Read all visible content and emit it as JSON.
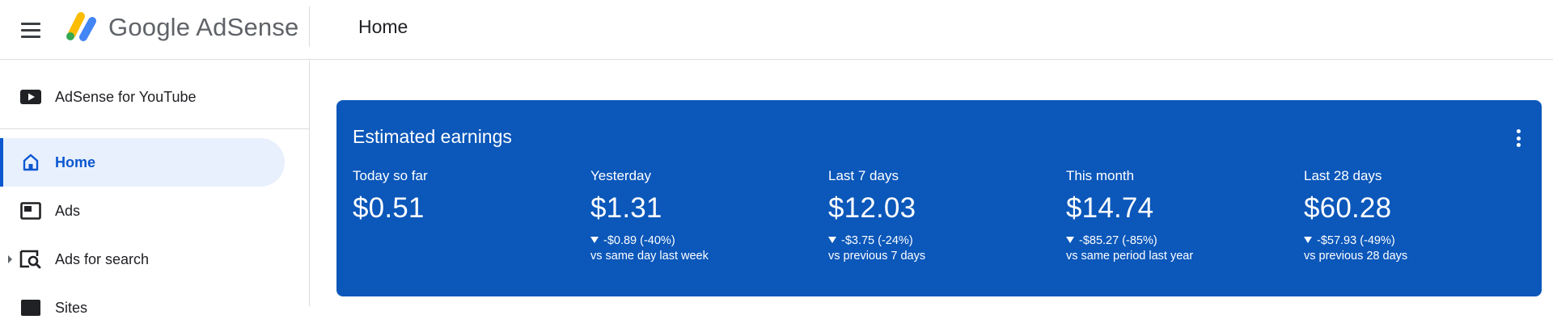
{
  "header": {
    "brand": "Google AdSense",
    "page_title": "Home"
  },
  "sidebar": {
    "items": [
      {
        "label": "AdSense for YouTube",
        "icon": "youtube-icon"
      },
      {
        "label": "Home",
        "icon": "home-icon",
        "active": true
      },
      {
        "label": "Ads",
        "icon": "ads-icon"
      },
      {
        "label": "Ads for search",
        "icon": "search-ads-icon"
      },
      {
        "label": "Sites",
        "icon": "sites-icon"
      }
    ]
  },
  "earnings": {
    "title": "Estimated earnings",
    "metrics": [
      {
        "label": "Today so far",
        "value": "$0.51",
        "change": "",
        "compare": ""
      },
      {
        "label": "Yesterday",
        "value": "$1.31",
        "change": "-$0.89 (-40%)",
        "compare": "vs same day last week"
      },
      {
        "label": "Last 7 days",
        "value": "$12.03",
        "change": "-$3.75 (-24%)",
        "compare": "vs previous 7 days"
      },
      {
        "label": "This month",
        "value": "$14.74",
        "change": "-$85.27 (-85%)",
        "compare": "vs same period last year"
      },
      {
        "label": "Last 28 days",
        "value": "$60.28",
        "change": "-$57.93 (-49%)",
        "compare": "vs previous 28 days"
      }
    ]
  },
  "colors": {
    "card_background": "#0b57ba",
    "active_accent": "#0b57d0",
    "active_background": "#e8f0fe"
  }
}
